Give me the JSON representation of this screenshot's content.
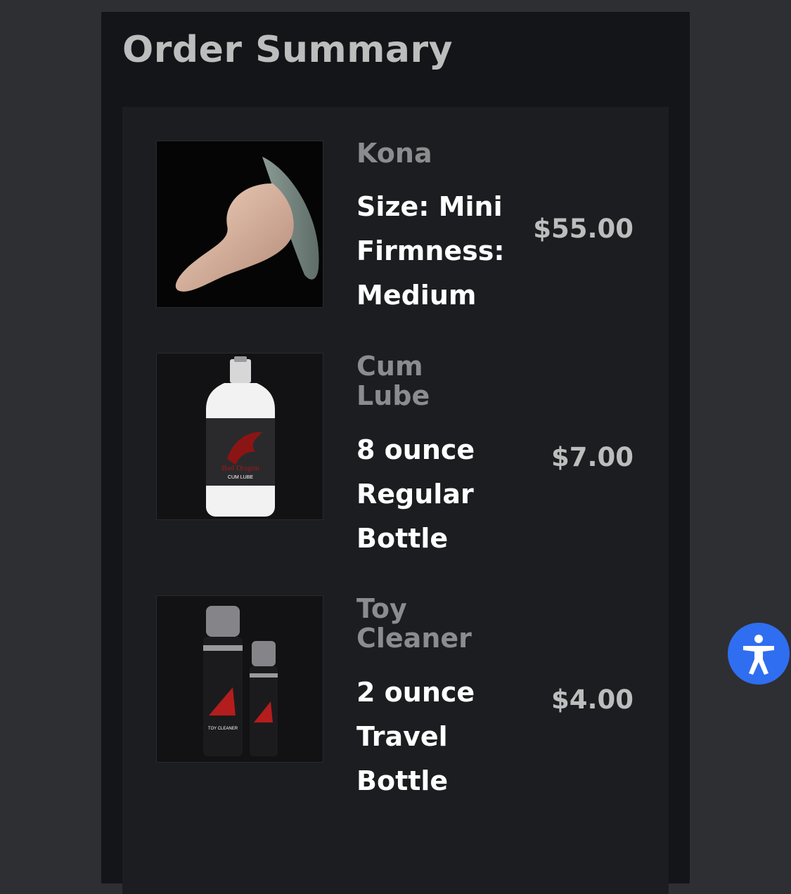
{
  "page": {
    "title": "Order Summary"
  },
  "items": [
    {
      "name": "Kona",
      "image_icon": "product-image-kona",
      "options": [
        "Size: Mini",
        "Firmness:",
        "Medium"
      ],
      "price": "$55.00"
    },
    {
      "name": "Cum Lube",
      "image_icon": "product-image-cum-lube",
      "image_brand": "Bad Dragon",
      "image_label": "CUM LUBE",
      "options": [
        "8 ounce",
        "Regular",
        "Bottle"
      ],
      "price": "$7.00"
    },
    {
      "name": "Toy Cleaner",
      "image_icon": "product-image-toy-cleaner",
      "image_label": "TOY CLEANER",
      "options": [
        "2 ounce",
        "Travel",
        "Bottle"
      ],
      "price": "$4.00"
    }
  ],
  "accessibility": {
    "icon": "accessibility-icon",
    "color": "#2f6ef0"
  },
  "colors": {
    "page_bg": "#2e2f33",
    "panel_bg": "#141518",
    "card_bg": "#1c1d21",
    "name_text": "#8c8c8f",
    "option_text": "#ffffff",
    "price_text": "#bdbdbd"
  }
}
